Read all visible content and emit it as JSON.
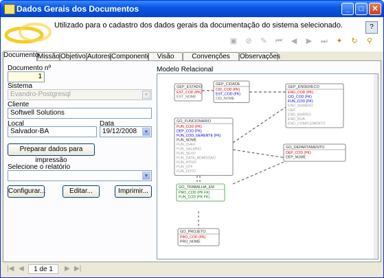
{
  "window": {
    "title": "Dados Gerais dos Documentos",
    "minimize": "_",
    "maximize": "□",
    "close": "✕"
  },
  "header": {
    "description": "Utilizado para o cadastro dos dados gerais da documentação do sistema selecionado."
  },
  "tabs": [
    {
      "label": "Documento"
    },
    {
      "label": "Missão"
    },
    {
      "label": "Objetivo"
    },
    {
      "label": "Autores"
    },
    {
      "label": "Componentes"
    },
    {
      "label": "Visão Geral"
    },
    {
      "label": "Convenções Adotadas"
    },
    {
      "label": "Observações"
    }
  ],
  "form": {
    "documento_label": "Documento nº",
    "documento_value": "1",
    "sistema_label": "Sistema",
    "sistema_value": "Evandro-Postgresql",
    "cliente_label": "Cliente",
    "cliente_value": "Softwell Solutions",
    "local_label": "Local",
    "local_value": "Salvador-BA",
    "data_label": "Data",
    "data_value": "19/12/2008",
    "preparar_label": "Preparar dados para impressão",
    "relatorio_label": "Selecione o relatório",
    "relatorio_value": "",
    "configurar_label": "Configurar...",
    "editar_label": "Editar...",
    "imprimir_label": "Imprimir..."
  },
  "model": {
    "label": "Modelo Relacional",
    "tables": [
      {
        "name": "GEP_ESTADO",
        "fields": [
          {
            "text": "EST_COD (PK)",
            "color": "#cc0000"
          },
          {
            "text": "EST_NOME",
            "color": "#666666"
          }
        ]
      },
      {
        "name": "GEP_CIDADE",
        "fields": [
          {
            "text": "CID_COD (PK)",
            "color": "#cc0000"
          },
          {
            "text": "EST_COD (FK)",
            "color": "#0000cc"
          },
          {
            "text": "CID_NOME",
            "color": "#666666"
          }
        ]
      },
      {
        "name": "GEP_ENDERECO",
        "fields": [
          {
            "text": "END_COD (PK)",
            "color": "#cc0000"
          },
          {
            "text": "CID_COD (FK)",
            "color": "#0000cc"
          },
          {
            "text": "FUN_COD (FK)",
            "color": "#0000cc"
          },
          {
            "text": "END_NUMERO",
            "color": "#999999"
          },
          {
            "text": "CEP",
            "color": "#999999"
          },
          {
            "text": "END_BAIRRO",
            "color": "#999999"
          },
          {
            "text": "END_RUA",
            "color": "#999999"
          },
          {
            "text": "END_COMPLEMENTO",
            "color": "#999999"
          }
        ]
      },
      {
        "name": "GO_FUNCIONARIO",
        "fields": [
          {
            "text": "FUN_COD (PK)",
            "color": "#cc0000"
          },
          {
            "text": "DEP_COD (FK)",
            "color": "#0000cc"
          },
          {
            "text": "FUN_COD_GERENTE (FK)",
            "color": "#0000cc"
          },
          {
            "text": "FUN_NOME",
            "color": "#333333"
          },
          {
            "text": "FUN_CHEF",
            "color": "#999999"
          },
          {
            "text": "FUN_SALARIO",
            "color": "#999999"
          },
          {
            "text": "FUN_SEXO",
            "color": "#999999"
          },
          {
            "text": "FUN_DATA_ADMISSAO",
            "color": "#999999"
          },
          {
            "text": "FUN_ATIVO",
            "color": "#999999"
          },
          {
            "text": "FUN_CPF",
            "color": "#999999"
          },
          {
            "text": "FUN_FOTO",
            "color": "#999999"
          }
        ]
      },
      {
        "name": "GO_DEPARTAMENTO",
        "fields": [
          {
            "text": "DEP_COD (PK)",
            "color": "#cc0000"
          },
          {
            "text": "DEP_NOME",
            "color": "#333333"
          }
        ]
      },
      {
        "name": "GO_TRABALHA_EM",
        "fields": [
          {
            "text": "PRO_COD (PK FK)",
            "color": "#007700"
          },
          {
            "text": "FUN_COD (PK FK)",
            "color": "#007700"
          }
        ]
      },
      {
        "name": "GO_PROJETO",
        "fields": [
          {
            "text": "PRO_COD (PK)",
            "color": "#cc0000"
          },
          {
            "text": "PRO_NOME",
            "color": "#333333"
          }
        ]
      }
    ]
  },
  "status": {
    "page": "1 de 1",
    "first": "|◀",
    "prev": "◀",
    "next": "▶",
    "last": "▶|"
  }
}
